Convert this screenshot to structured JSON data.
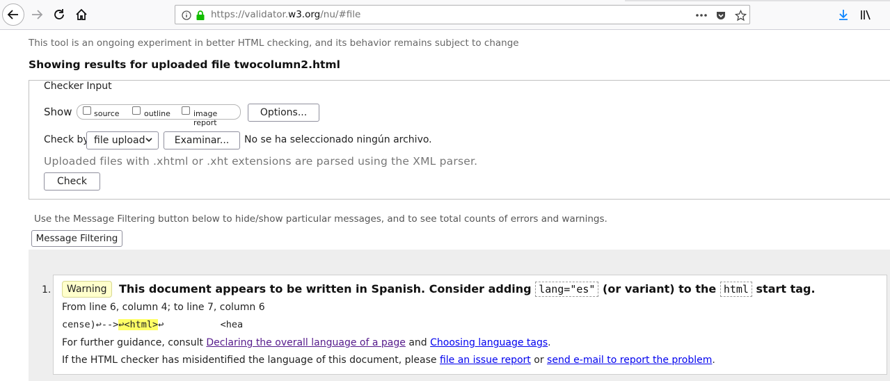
{
  "browser": {
    "url_prefix": "https://validator.",
    "url_host": "w3.org",
    "url_suffix": "/nu/#file"
  },
  "page": {
    "tagline": "This tool is an ongoing experiment in better HTML checking, and its behavior remains subject to change",
    "results_title": "Showing results for uploaded file twocolumn2.html"
  },
  "checker": {
    "legend": "Checker Input",
    "show_label": "Show",
    "show_options": [
      "source",
      "outline",
      "image report"
    ],
    "options_button": "Options...",
    "checkby_label": "Check by",
    "checkby_value": "file upload",
    "browse_button": "Examinar...",
    "no_file_text": "No se ha seleccionado ningún archivo.",
    "xml_note": "Uploaded files with .xhtml or .xht extensions are parsed using the XML parser.",
    "check_button": "Check"
  },
  "filtering": {
    "note": "Use the Message Filtering button below to hide/show particular messages, and to see total counts of errors and warnings.",
    "button": "Message Filtering"
  },
  "messages": [
    {
      "number": "1.",
      "type": "Warning",
      "title_part1": "This document appears to be written in Spanish. Consider adding",
      "code1": "lang=\"es\"",
      "title_part2": "(or variant) to the",
      "code2": "html",
      "title_part3": "start tag.",
      "location": "From line 6, column 4; to line 7, column 6",
      "extract_before": "cense)↩-->",
      "extract_highlight": "↩<html>",
      "extract_after": "↩          <hea",
      "guidance_prefix": "For further guidance, consult",
      "guidance_link1": "Declaring the overall language of a page",
      "guidance_and": "and",
      "guidance_link2": "Choosing language tags",
      "guidance_end": ".",
      "report_prefix": "If the HTML checker has misidentified the language of this document, please",
      "report_link1": "file an issue report",
      "report_or": "or",
      "report_link2": "send e-mail to report the problem",
      "report_end": "."
    }
  ]
}
